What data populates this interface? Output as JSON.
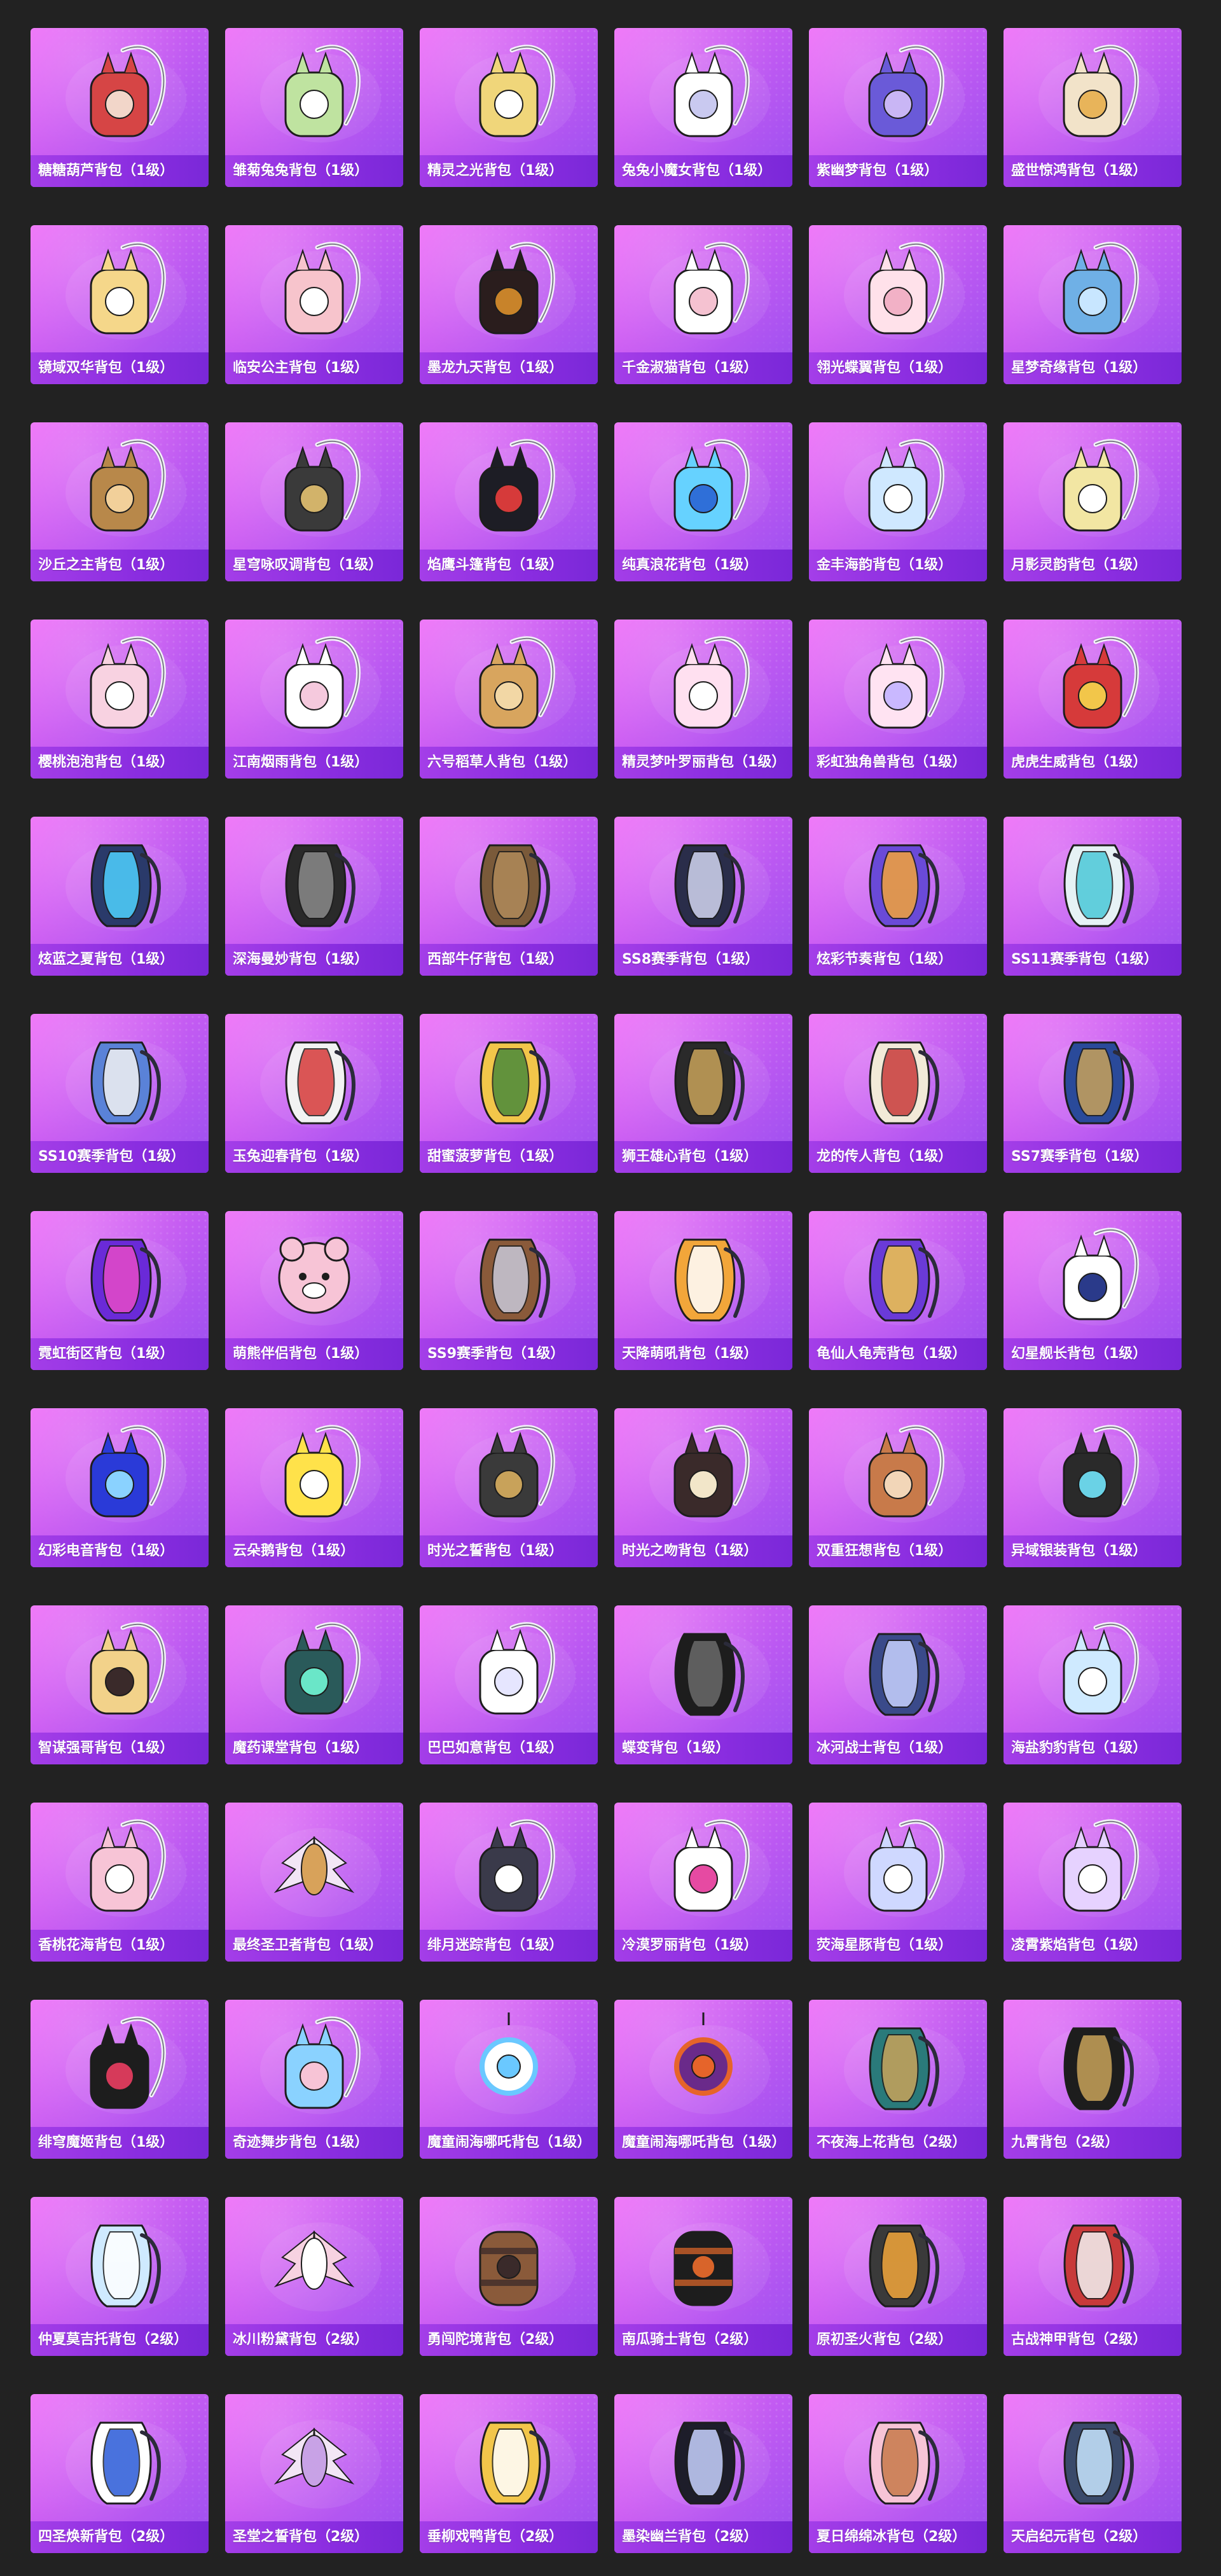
{
  "page": {
    "background": "#222222",
    "card_gradient": [
      "#ee6ef8",
      "#c75cf2",
      "#9a4ff0"
    ],
    "label_bar_color": "#8a2de0"
  },
  "items": [
    {
      "label": "糖糖葫芦背包（1级）",
      "icon": "backpack-icon",
      "colors": [
        "#d64545",
        "#f2d6c9"
      ],
      "style": "strap"
    },
    {
      "label": "雏菊兔兔背包（1级）",
      "icon": "backpack-icon",
      "colors": [
        "#bfe3a0",
        "#ffffff"
      ],
      "style": "strap"
    },
    {
      "label": "精灵之光背包（1级）",
      "icon": "backpack-icon",
      "colors": [
        "#f0d67a",
        "#ffffff"
      ],
      "style": "strap"
    },
    {
      "label": "兔兔小魔女背包（1级）",
      "icon": "backpack-icon",
      "colors": [
        "#ffffff",
        "#c9c9f0"
      ],
      "style": "strap"
    },
    {
      "label": "紫幽梦背包（1级）",
      "icon": "backpack-icon",
      "colors": [
        "#6a5ad8",
        "#c9b6f5"
      ],
      "style": "strap"
    },
    {
      "label": "盛世惊鸿背包（1级）",
      "icon": "backpack-icon",
      "colors": [
        "#f2e3c9",
        "#e8b45a"
      ],
      "style": "strap"
    },
    {
      "label": "镜域双华背包（1级）",
      "icon": "backpack-icon",
      "colors": [
        "#f5d78a",
        "#ffffff"
      ],
      "style": "strap"
    },
    {
      "label": "临安公主背包（1级）",
      "icon": "backpack-icon",
      "colors": [
        "#f7c4cc",
        "#ffffff"
      ],
      "style": "strap"
    },
    {
      "label": "墨龙九天背包（1级）",
      "icon": "backpack-icon",
      "colors": [
        "#2a1d1d",
        "#c8832a"
      ],
      "style": "strap"
    },
    {
      "label": "千金淑猫背包（1级）",
      "icon": "backpack-icon",
      "colors": [
        "#ffffff",
        "#f5c2d1"
      ],
      "style": "strap"
    },
    {
      "label": "翎光蝶翼背包（1级）",
      "icon": "backpack-icon",
      "colors": [
        "#ffe1ea",
        "#f2b1c6"
      ],
      "style": "strap"
    },
    {
      "label": "星梦奇缘背包（1级）",
      "icon": "backpack-icon",
      "colors": [
        "#6fb0e6",
        "#c8e6ff"
      ],
      "style": "strap"
    },
    {
      "label": "沙丘之主背包（1级）",
      "icon": "backpack-icon",
      "colors": [
        "#b8884a",
        "#f2d09a"
      ],
      "style": "strap"
    },
    {
      "label": "星穹咏叹调背包（1级）",
      "icon": "backpack-icon",
      "colors": [
        "#3a3a3a",
        "#d2b36a"
      ],
      "style": "strap"
    },
    {
      "label": "焰鹰斗篷背包（1级）",
      "icon": "backpack-icon",
      "colors": [
        "#1d1d25",
        "#d63a3a"
      ],
      "style": "strap"
    },
    {
      "label": "纯真浪花背包（1级）",
      "icon": "backpack-icon",
      "colors": [
        "#66d2ff",
        "#2f6fd8"
      ],
      "style": "strap"
    },
    {
      "label": "金丰海韵背包（1级）",
      "icon": "backpack-icon",
      "colors": [
        "#cfe8ff",
        "#ffffff"
      ],
      "style": "strap"
    },
    {
      "label": "月影灵韵背包（1级）",
      "icon": "backpack-icon",
      "colors": [
        "#f2e6a3",
        "#ffffff"
      ],
      "style": "strap"
    },
    {
      "label": "樱桃泡泡背包（1级）",
      "icon": "backpack-icon",
      "colors": [
        "#f8d2e1",
        "#ffffff"
      ],
      "style": "strap"
    },
    {
      "label": "江南烟雨背包（1级）",
      "icon": "backpack-icon",
      "colors": [
        "#ffffff",
        "#f5c9dd"
      ],
      "style": "strap"
    },
    {
      "label": "六号稻草人背包（1级）",
      "icon": "backpack-icon",
      "colors": [
        "#d8a55e",
        "#f2d7a5"
      ],
      "style": "strap"
    },
    {
      "label": "精灵梦叶罗丽背包（1级）",
      "icon": "backpack-icon",
      "colors": [
        "#ffe0f0",
        "#ffffff"
      ],
      "style": "strap"
    },
    {
      "label": "彩虹独角兽背包（1级）",
      "icon": "backpack-icon",
      "colors": [
        "#ffe3f2",
        "#c9b8ff"
      ],
      "style": "strap"
    },
    {
      "label": "虎虎生威背包（1级）",
      "icon": "backpack-icon",
      "colors": [
        "#d63a3a",
        "#f2c64a"
      ],
      "style": "strap"
    },
    {
      "label": "炫蓝之夏背包（1级）",
      "icon": "backpack-icon",
      "colors": [
        "#2a3a6a",
        "#4fd2ff"
      ],
      "style": "pack"
    },
    {
      "label": "深海曼妙背包（1级）",
      "icon": "backpack-icon",
      "colors": [
        "#2a2a2a",
        "#8a8a8a"
      ],
      "style": "pack"
    },
    {
      "label": "西部牛仔背包（1级）",
      "icon": "backpack-icon",
      "colors": [
        "#7a5a3a",
        "#b08a5a"
      ],
      "style": "pack"
    },
    {
      "label": "SS8赛季背包（1级）",
      "icon": "backpack-icon",
      "colors": [
        "#2a2d4a",
        "#d2d6f0"
      ],
      "style": "pack"
    },
    {
      "label": "炫彩节奏背包（1级）",
      "icon": "backpack-icon",
      "colors": [
        "#6a4ad8",
        "#f2a33a"
      ],
      "style": "pack"
    },
    {
      "label": "SS11赛季背包（1级）",
      "icon": "backpack-icon",
      "colors": [
        "#e6f2f5",
        "#4ac8d8"
      ],
      "style": "pack"
    },
    {
      "label": "SS10赛季背包（1级）",
      "icon": "backpack-icon",
      "colors": [
        "#5a82d8",
        "#f2f2f2"
      ],
      "style": "pack"
    },
    {
      "label": "玉兔迎春背包（1级）",
      "icon": "backpack-icon",
      "colors": [
        "#f2f2f2",
        "#d63a3a"
      ],
      "style": "pack"
    },
    {
      "label": "甜蜜菠萝背包（1级）",
      "icon": "backpack-icon",
      "colors": [
        "#f2c64a",
        "#4a8a3a"
      ],
      "style": "pack"
    },
    {
      "label": "狮王雄心背包（1级）",
      "icon": "backpack-icon",
      "colors": [
        "#2a2a2a",
        "#c8a25a"
      ],
      "style": "pack"
    },
    {
      "label": "龙的传人背包（1级）",
      "icon": "backpack-icon",
      "colors": [
        "#f2ead8",
        "#c83a3a"
      ],
      "style": "pack"
    },
    {
      "label": "SS7赛季背包（1级）",
      "icon": "backpack-icon",
      "colors": [
        "#2a4a9a",
        "#c8a25a"
      ],
      "style": "pack"
    },
    {
      "label": "霓虹街区背包（1级）",
      "icon": "backpack-icon",
      "colors": [
        "#6a2ad8",
        "#e64ac8"
      ],
      "style": "pack"
    },
    {
      "label": "萌熊伴侣背包（1级）",
      "icon": "backpack-icon",
      "colors": [
        "#f7c4d6",
        "#ffffff"
      ],
      "style": "plush"
    },
    {
      "label": "SS9赛季背包（1级）",
      "icon": "backpack-icon",
      "colors": [
        "#8a5a3a",
        "#c8c8d8"
      ],
      "style": "pack"
    },
    {
      "label": "天降萌吼背包（1级）",
      "icon": "backpack-icon",
      "colors": [
        "#f2a63a",
        "#ffffff"
      ],
      "style": "pack"
    },
    {
      "label": "龟仙人龟壳背包（1级）",
      "icon": "backpack-icon",
      "colors": [
        "#6a3ad8",
        "#f2c64a"
      ],
      "style": "pack"
    },
    {
      "label": "幻星舰长背包（1级）",
      "icon": "backpack-icon",
      "colors": [
        "#ffffff",
        "#2a3a8a"
      ],
      "style": "strap"
    },
    {
      "label": "幻彩电音背包（1级）",
      "icon": "backpack-icon",
      "colors": [
        "#2a3ad8",
        "#8ad2ff"
      ],
      "style": "strap"
    },
    {
      "label": "云朵鹅背包（1级）",
      "icon": "backpack-icon",
      "colors": [
        "#ffe24a",
        "#ffffff"
      ],
      "style": "strap"
    },
    {
      "label": "时光之誓背包（1级）",
      "icon": "backpack-icon",
      "colors": [
        "#3a3a3a",
        "#c8a25a"
      ],
      "style": "strap"
    },
    {
      "label": "时光之吻背包（1级）",
      "icon": "backpack-icon",
      "colors": [
        "#3a2a2a",
        "#f2e6c9"
      ],
      "style": "strap"
    },
    {
      "label": "双重狂想背包（1级）",
      "icon": "backpack-icon",
      "colors": [
        "#c87a4a",
        "#f2d6b8"
      ],
      "style": "strap"
    },
    {
      "label": "异域银装背包（1级）",
      "icon": "backpack-icon",
      "colors": [
        "#2a2a2a",
        "#6ad2e6"
      ],
      "style": "strap"
    },
    {
      "label": "智谋强哥背包（1级）",
      "icon": "backpack-icon",
      "colors": [
        "#f2d28a",
        "#3a2a2a"
      ],
      "style": "strap"
    },
    {
      "label": "魔药课堂背包（1级）",
      "icon": "backpack-icon",
      "colors": [
        "#2a5a5a",
        "#6ae6c8"
      ],
      "style": "strap"
    },
    {
      "label": "巴巴如意背包（1级）",
      "icon": "backpack-icon",
      "colors": [
        "#ffffff",
        "#e6e6ff"
      ],
      "style": "strap"
    },
    {
      "label": "蝶变背包（1级）",
      "icon": "backpack-icon",
      "colors": [
        "#1d1d1d",
        "#6a6a6a"
      ],
      "style": "pack"
    },
    {
      "label": "冰河战士背包（1级）",
      "icon": "backpack-icon",
      "colors": [
        "#3a4a8a",
        "#c8d2ff"
      ],
      "style": "pack"
    },
    {
      "label": "海盐豹豹背包（1级）",
      "icon": "backpack-icon",
      "colors": [
        "#cfeaff",
        "#ffffff"
      ],
      "style": "strap"
    },
    {
      "label": "香桃花海背包（1级）",
      "icon": "backpack-icon",
      "colors": [
        "#f7c4d6",
        "#ffffff"
      ],
      "style": "strap"
    },
    {
      "label": "最终圣卫者背包（1级）",
      "icon": "backpack-icon",
      "colors": [
        "#f2e6f5",
        "#d8a25a"
      ],
      "style": "wings"
    },
    {
      "label": "绯月迷踪背包（1级）",
      "icon": "backpack-icon",
      "colors": [
        "#3a3a4a",
        "#ffffff"
      ],
      "style": "strap"
    },
    {
      "label": "冷漠罗丽背包（1级）",
      "icon": "backpack-icon",
      "colors": [
        "#ffffff",
        "#e64aa2"
      ],
      "style": "strap"
    },
    {
      "label": "荧海星豚背包（1级）",
      "icon": "backpack-icon",
      "colors": [
        "#cfd8ff",
        "#ffffff"
      ],
      "style": "strap"
    },
    {
      "label": "凌霄紫焰背包（1级）",
      "icon": "backpack-icon",
      "colors": [
        "#e6d2ff",
        "#ffffff"
      ],
      "style": "strap"
    },
    {
      "label": "绯穹魔姬背包（1级）",
      "icon": "backpack-icon",
      "colors": [
        "#1d1d1d",
        "#d63a5a"
      ],
      "style": "strap"
    },
    {
      "label": "奇迹舞步背包（1级）",
      "icon": "backpack-icon",
      "colors": [
        "#8ad2ff",
        "#f7c4d6"
      ],
      "style": "strap"
    },
    {
      "label": "魔童闹海哪吒背包（1级）",
      "icon": "backpack-icon",
      "colors": [
        "#6ac8ff",
        "#ffffff"
      ],
      "style": "orb"
    },
    {
      "label": "魔童闹海哪吒背包（1级）",
      "icon": "backpack-icon",
      "colors": [
        "#e6642a",
        "#6a2a8a"
      ],
      "style": "orb"
    },
    {
      "label": "不夜海上花背包（2级）",
      "icon": "backpack-icon",
      "colors": [
        "#2a7a7a",
        "#c8a25a"
      ],
      "style": "pack"
    },
    {
      "label": "九霄背包（2级）",
      "icon": "backpack-icon",
      "colors": [
        "#1d1d1d",
        "#c8a25a"
      ],
      "style": "pack"
    },
    {
      "label": "仲夏莫吉托背包（2级）",
      "icon": "backpack-icon",
      "colors": [
        "#cfeaff",
        "#ffffff"
      ],
      "style": "pack"
    },
    {
      "label": "冰川粉黛背包（2级）",
      "icon": "backpack-icon",
      "colors": [
        "#f7d2e1",
        "#ffffff"
      ],
      "style": "wings"
    },
    {
      "label": "勇闯陀境背包（2级）",
      "icon": "backpack-icon",
      "colors": [
        "#3a2a2a",
        "#8a5a3a"
      ],
      "style": "barrel"
    },
    {
      "label": "南瓜骑士背包（2级）",
      "icon": "backpack-icon",
      "colors": [
        "#d8642a",
        "#1d1d1d"
      ],
      "style": "barrel"
    },
    {
      "label": "原初圣火背包（2级）",
      "icon": "backpack-icon",
      "colors": [
        "#3a3a3a",
        "#f2a63a"
      ],
      "style": "pack"
    },
    {
      "label": "古战神甲背包（2级）",
      "icon": "backpack-icon",
      "colors": [
        "#c83a3a",
        "#f2f2f2"
      ],
      "style": "pack"
    },
    {
      "label": "四圣焕新背包（2级）",
      "icon": "backpack-icon",
      "colors": [
        "#ffffff",
        "#2a5ad8"
      ],
      "style": "pack"
    },
    {
      "label": "圣堂之誓背包（2级）",
      "icon": "backpack-icon",
      "colors": [
        "#f2e6f5",
        "#c8a2e6"
      ],
      "style": "wings"
    },
    {
      "label": "垂柳戏鸭背包（2级）",
      "icon": "backpack-icon",
      "colors": [
        "#f2c64a",
        "#ffffff"
      ],
      "style": "pack"
    },
    {
      "label": "墨染幽兰背包（2级）",
      "icon": "backpack-icon",
      "colors": [
        "#1d1d2a",
        "#c8d2ff"
      ],
      "style": "pack"
    },
    {
      "label": "夏日绵绵冰背包（2级）",
      "icon": "backpack-icon",
      "colors": [
        "#f7c4d6",
        "#c87a4a"
      ],
      "style": "pack"
    },
    {
      "label": "天启纪元背包（2级）",
      "icon": "backpack-icon",
      "colors": [
        "#3a4a6a",
        "#c8e6ff"
      ],
      "style": "pack"
    }
  ]
}
